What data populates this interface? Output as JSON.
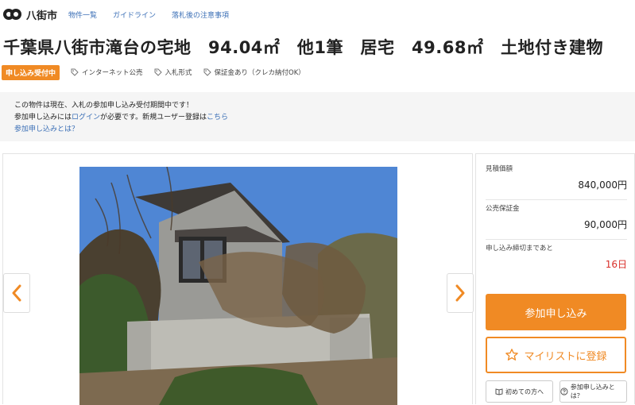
{
  "header": {
    "logo_text": "八街市",
    "nav": [
      "物件一覧",
      "ガイドライン",
      "落札後の注意事項"
    ]
  },
  "title": "千葉県八街市滝台の宅地　94.04㎡　他1筆　居宅　49.68㎡　土地付き建物",
  "tags": {
    "status": "申し込み受付中",
    "items": [
      "インターネット公売",
      "入札形式",
      "保証金あり（クレカ納付OK）"
    ]
  },
  "notice": {
    "line1": "この物件は現在、入札の参加申し込み受付期間中です！",
    "line2_prefix": "参加申し込みには",
    "line2_login": "ログイン",
    "line2_mid": "が必要です。新規ユーザー登録は",
    "line2_here": "こちら",
    "line3": "参加申し込みとは？"
  },
  "side": {
    "estimate_label": "見積価額",
    "estimate_value": "840,000円",
    "deposit_label": "公売保証金",
    "deposit_value": "90,000円",
    "deadline_label": "申し込み締切まであと",
    "deadline_value": "16日",
    "apply_label": "参加申し込み",
    "mylist_label": "マイリストに登録",
    "first_time_label": "初めての方へ",
    "what_is_label": "参加申し込みとは？"
  },
  "colors": {
    "accent": "#f08a24",
    "link": "#3b6fb6",
    "deadline": "#d9302a"
  }
}
